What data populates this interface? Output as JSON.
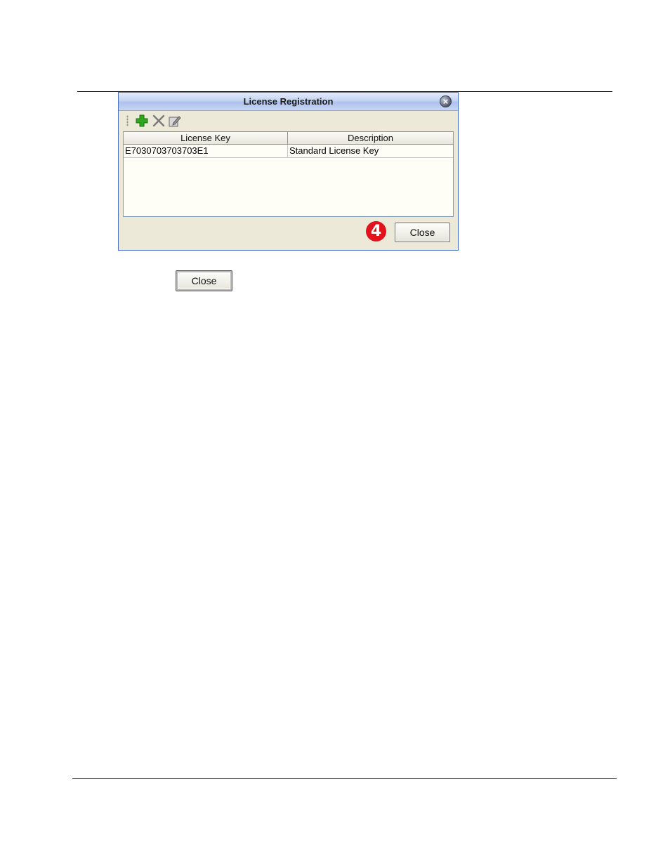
{
  "dialog": {
    "title": "License Registration",
    "toolbar": {
      "add_icon": "add-icon",
      "delete_icon": "delete-icon",
      "edit_icon": "edit-icon"
    },
    "table": {
      "columns": [
        "License Key",
        "Description"
      ],
      "rows": [
        [
          "E7030703703703E1",
          "Standard License Key"
        ]
      ]
    },
    "callout_number": "4",
    "close_label": "Close"
  },
  "standalone_button": {
    "label": "Close"
  },
  "colors": {
    "titlebar": "#c3d3f3",
    "dialog_bg": "#ece9d8",
    "callout": "#e2131b",
    "add_icon": "#2fa81f"
  }
}
